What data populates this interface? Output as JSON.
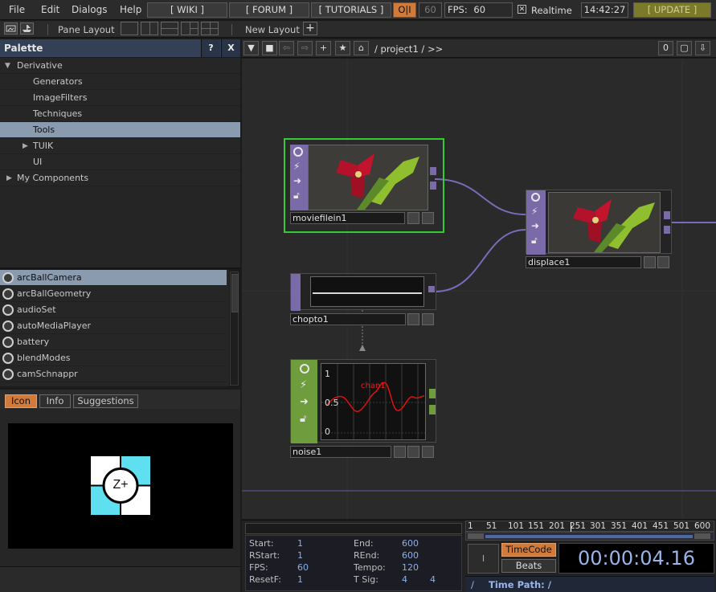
{
  "menubar": {
    "items": [
      "File",
      "Edit",
      "Dialogs",
      "Help"
    ],
    "wiki": "[ WIKI ]",
    "forum": "[ FORUM ]",
    "tutorials": "[ TUTORIALS ]",
    "oi": "O|I",
    "count": "60",
    "fps_label": "FPS:",
    "fps_value": "60",
    "realtime": "Realtime",
    "clock": "14:42:27",
    "update": "[ UPDATE ]"
  },
  "toolbar": {
    "pane_layout": "Pane Layout",
    "new_layout": "New Layout"
  },
  "palette": {
    "title": "Palette",
    "help": "?",
    "close": "X",
    "tree": [
      {
        "label": "Derivative",
        "arrow": "down"
      },
      {
        "label": "Generators"
      },
      {
        "label": "ImageFilters"
      },
      {
        "label": "Techniques"
      },
      {
        "label": "Tools",
        "selected": true
      },
      {
        "label": "TUIK",
        "arrow": "right"
      },
      {
        "label": "UI"
      },
      {
        "label": "My Components",
        "arrow": "right"
      }
    ],
    "components": [
      "arcBallCamera",
      "arcBallGeometry",
      "audioSet",
      "autoMediaPlayer",
      "battery",
      "blendModes",
      "camSchnappr"
    ],
    "tabs": [
      "Icon",
      "Info",
      "Suggestions"
    ],
    "preview_glyph": "Z+"
  },
  "network": {
    "path": "/ project1 / >>",
    "count": "0",
    "nodes": {
      "moviefilein": "moviefilein1",
      "displace": "displace1",
      "chopto": "chopto1",
      "noise": "noise1",
      "chan": "chan1",
      "y_labels": [
        "1",
        "0.5",
        "0"
      ]
    }
  },
  "timeline": {
    "start_label": "Start:",
    "start": "1",
    "end_label": "End:",
    "end": "600",
    "rstart_label": "RStart:",
    "rstart": "1",
    "rend_label": "REnd:",
    "rend": "600",
    "fps_label": "FPS:",
    "fps": "60",
    "tempo_label": "Tempo:",
    "tempo": "120",
    "resetf_label": "ResetF:",
    "resetf": "1",
    "tsig_label": "T Sig:",
    "tsig_a": "4",
    "tsig_b": "4",
    "ruler": [
      "1",
      "51",
      "101",
      "151",
      "201",
      "251",
      "301",
      "351",
      "401",
      "451",
      "501",
      "600"
    ],
    "timecode_btn": "TimeCode",
    "beats_btn": "Beats",
    "play_glyph": "I",
    "timecode": "00:00:04.16",
    "slash": "/",
    "time_path": "Time Path: /"
  }
}
